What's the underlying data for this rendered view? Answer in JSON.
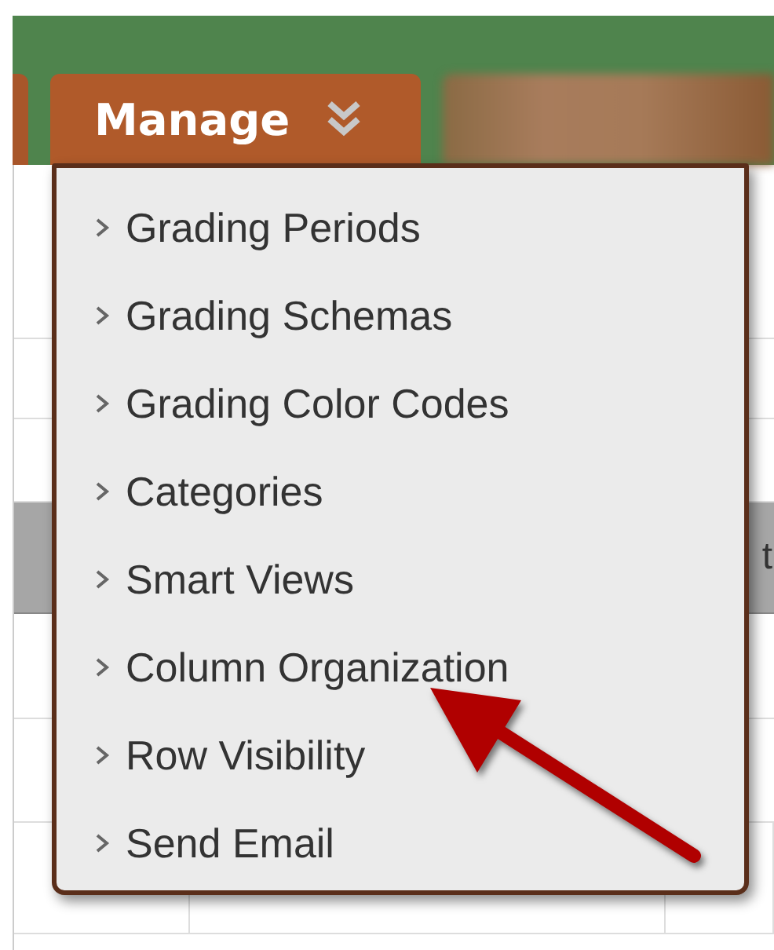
{
  "toolbar": {
    "manage_button": {
      "label": "Manage",
      "expanded": true
    }
  },
  "menu": {
    "items": [
      {
        "label": "Grading Periods"
      },
      {
        "label": "Grading Schemas"
      },
      {
        "label": "Grading Color Codes"
      },
      {
        "label": "Categories"
      },
      {
        "label": "Smart Views"
      },
      {
        "label": "Column Organization"
      },
      {
        "label": "Row Visibility"
      },
      {
        "label": "Send Email"
      }
    ]
  },
  "table": {
    "column_3": "t"
  }
}
